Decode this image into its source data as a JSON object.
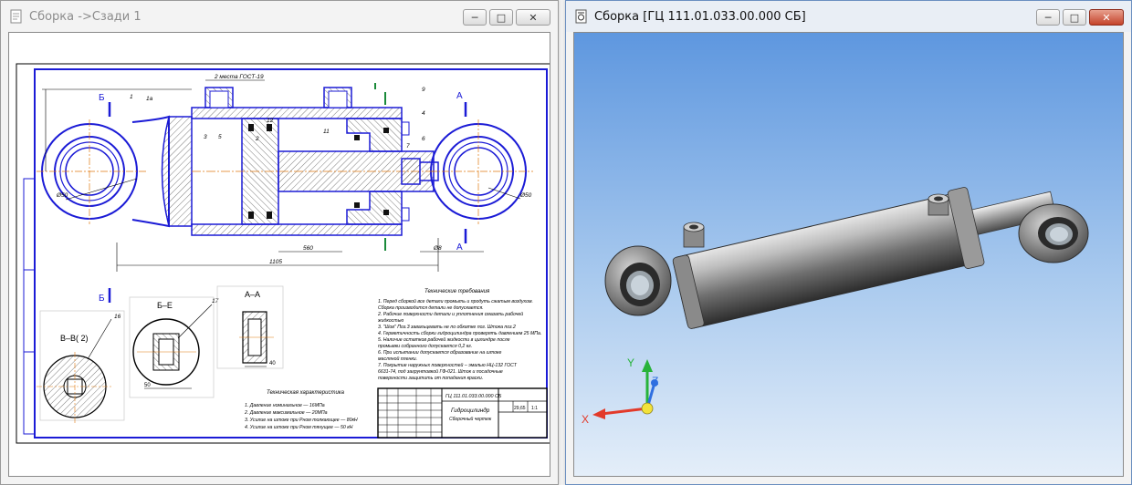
{
  "windows": {
    "drawing": {
      "title": "Сборка ->Сзади 1",
      "minimize_glyph": "─",
      "maximize_glyph": "□",
      "close_glyph": "✕",
      "icon": "document-icon"
    },
    "model": {
      "title": "Сборка [ГЦ 111.01.033.00.000 СБ]",
      "minimize_glyph": "─",
      "maximize_glyph": "□",
      "close_glyph": "✕",
      "icon": "assembly-document-icon"
    }
  },
  "drawing_sheet": {
    "section_labels": {
      "b_left": "Б",
      "b_bottom": "Б",
      "a_top": "А",
      "a_bottom": "А",
      "view_bb": "Б–Б",
      "view_aa": "А–А",
      "view_e": "Б–Е",
      "view_b_rotated": "В–В( 2)"
    },
    "callouts": [
      "1",
      "1а",
      "3",
      "5",
      "2",
      "9",
      "4",
      "6",
      "7",
      "11",
      "12",
      "16",
      "17"
    ],
    "dimensions": {
      "top_thread": "2 места ГОСТ-19",
      "overall_length": "1105",
      "stroke_partial": "560",
      "bottom_right": "Ø8",
      "eye_left": "Ø50",
      "eye_right": "Ø50",
      "sec_h": "50",
      "aa_w": "40"
    },
    "tech_requirements": {
      "title": "Технические требования",
      "lines": [
        "1. Перед сборкой все детали промыть и продуть сжатым воздухом.",
        "Сборка производится детали не допускается.",
        "2. Рабочие поверхности детали и уплотнения смазать рабочей",
        "жидкостью",
        "3. \"Шов\" Поз.3 завальцевать не по обкатке поз. Штока поз.2",
        "4. Герметичность сборки гидроцилиндра проверять давлением 25 МПа.",
        "5. Наличие остатков рабочей жидкости в цилиндре после",
        "промывки собранного допускается 0,2 кг.",
        "6. При испытании допускается образование на штоке",
        "масляной пленки.",
        "7. Покрытие наружных поверхностей – эмалью НЦ-132 ГОСТ",
        "6631-74, под загрунтовкой ГФ-021. Шток и посадочные",
        "поверхности защитить от попадания краски."
      ]
    },
    "tech_characteristics": {
      "title": "Техническая характеристика",
      "lines": [
        "1. Давление номинальное — 16МПа",
        "2. Давление максимальное — 20МПа",
        "3. Усилие на штоке при Pном толкающее — 80кН",
        "4. Усилие на штоке при Pном тянущее — 50 кН"
      ]
    },
    "title_block": {
      "name_line1": "Гидроцилиндр",
      "name_line2": "Сборочный чертеж",
      "code": "ГЦ 111.01.033.00.000 СБ",
      "scale": "1:1",
      "mass": "29,65"
    }
  },
  "model_view": {
    "axes": {
      "x": "X",
      "y": "Y",
      "z": "Z"
    },
    "colors": {
      "x_axis": "#e23a2a",
      "y_axis": "#27b33a",
      "z_axis": "#2f6fe0",
      "origin": "#f2e23a"
    }
  }
}
